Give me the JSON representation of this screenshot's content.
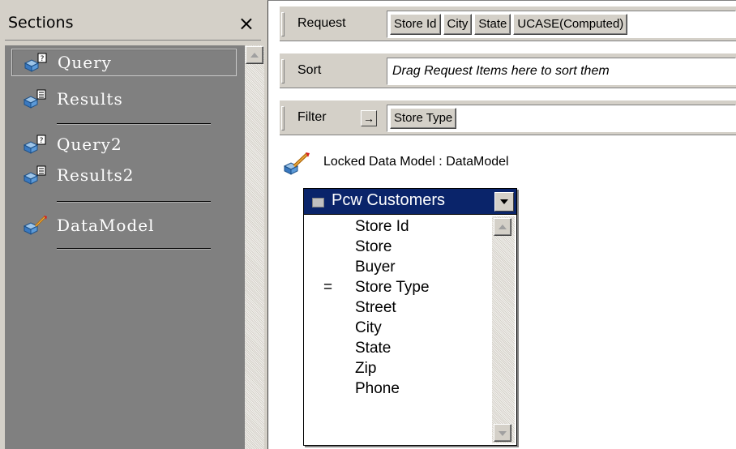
{
  "sections_pane": {
    "title": "Sections",
    "close": "×",
    "items": [
      {
        "label": "Query",
        "icon": "query-section-icon",
        "selected": true
      },
      {
        "label": "Results",
        "icon": "results-section-icon",
        "selected": false
      },
      {
        "label": "Query2",
        "icon": "query-section-icon",
        "selected": false
      },
      {
        "label": "Results2",
        "icon": "results-section-icon",
        "selected": false
      },
      {
        "label": "DataModel",
        "icon": "datamodel-section-icon",
        "selected": false
      }
    ]
  },
  "request_line": {
    "label": "Request",
    "items": [
      "Store Id",
      "City",
      "State",
      "UCASE(Computed)"
    ]
  },
  "sort_line": {
    "label": "Sort",
    "hint": "Drag Request Items here to sort them"
  },
  "filter_line": {
    "label": "Filter",
    "arrow": "→",
    "items": [
      "Store Type"
    ]
  },
  "data_model": {
    "caption": "Locked Data Model : DataModel",
    "topic": {
      "title": "Pcw Customers",
      "items": [
        {
          "label": "Store Id",
          "marker": ""
        },
        {
          "label": "Store",
          "marker": ""
        },
        {
          "label": "Buyer",
          "marker": ""
        },
        {
          "label": "Store Type",
          "marker": "="
        },
        {
          "label": "Street",
          "marker": ""
        },
        {
          "label": "City",
          "marker": ""
        },
        {
          "label": "State",
          "marker": ""
        },
        {
          "label": "Zip",
          "marker": ""
        },
        {
          "label": "Phone",
          "marker": ""
        }
      ]
    }
  },
  "colors": {
    "sections_list_bg": "#808080",
    "topic_title_bg": "#0a246a",
    "chrome": "#d4d0c8"
  }
}
